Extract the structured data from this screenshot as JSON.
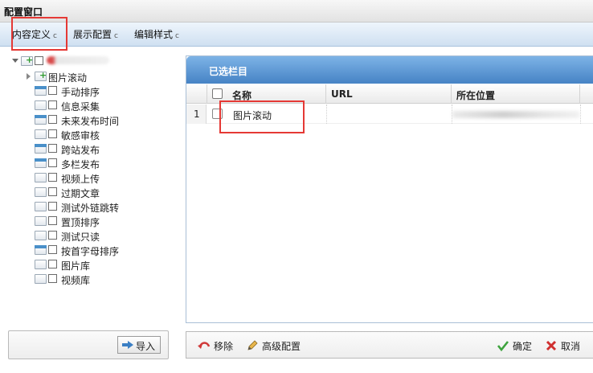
{
  "window": {
    "title": "配置窗口"
  },
  "tabs": [
    {
      "label": "内容定义"
    },
    {
      "label": "展示配置"
    },
    {
      "label": "编辑样式"
    }
  ],
  "tabs_refresh_glyph": "c",
  "tree": {
    "root_child": "图片滚动",
    "items": [
      {
        "label": "手动排序",
        "folder": "blue"
      },
      {
        "label": "信息采集",
        "folder": "plain"
      },
      {
        "label": "未来发布时间",
        "folder": "blue"
      },
      {
        "label": "敏感审核",
        "folder": "plain"
      },
      {
        "label": "跨站发布",
        "folder": "blue"
      },
      {
        "label": "多栏发布",
        "folder": "blue"
      },
      {
        "label": "视频上传",
        "folder": "plain"
      },
      {
        "label": "过期文章",
        "folder": "plain"
      },
      {
        "label": "测试外链跳转",
        "folder": "plain"
      },
      {
        "label": "置顶排序",
        "folder": "plain"
      },
      {
        "label": "测试只读",
        "folder": "plain"
      },
      {
        "label": "按首字母排序",
        "folder": "blue"
      },
      {
        "label": "图片库",
        "folder": "plain"
      },
      {
        "label": "视频库",
        "folder": "plain"
      }
    ],
    "import_label": "导入"
  },
  "selected_panel": {
    "title": "已选栏目",
    "columns": {
      "name": "名称",
      "url": "URL",
      "location": "所在位置"
    },
    "rows": [
      {
        "num": "1",
        "name": "图片滚动",
        "url": ""
      }
    ]
  },
  "toolbar": {
    "remove_label": "移除",
    "advanced_label": "高级配置",
    "ok_label": "确定",
    "cancel_label": "取消"
  },
  "colors": {
    "panel_header": "#5b95d4",
    "highlight": "#e53935",
    "folder_blue": "#4a90c9"
  }
}
